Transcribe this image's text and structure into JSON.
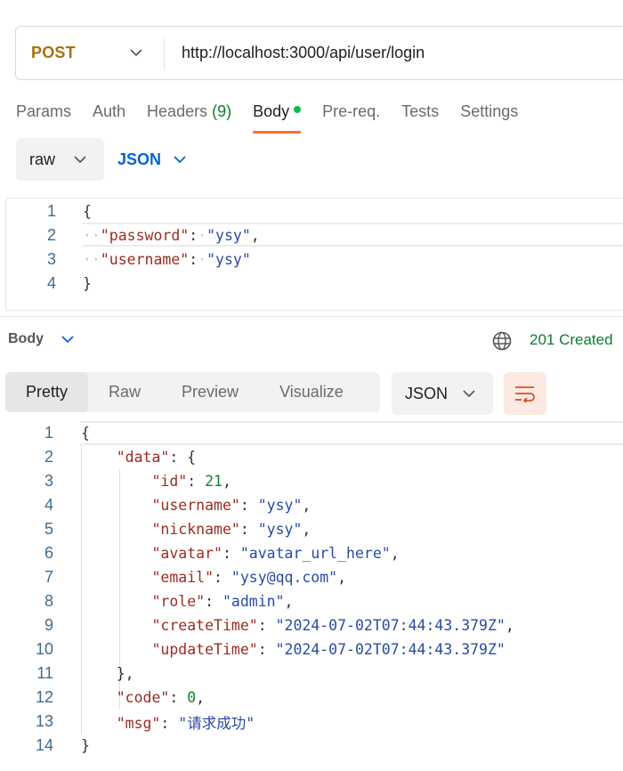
{
  "request": {
    "method": "POST",
    "url": "http://localhost:3000/api/user/login"
  },
  "request_tabs": [
    {
      "label": "Params"
    },
    {
      "label": "Auth"
    },
    {
      "label": "Headers",
      "count": "(9)"
    },
    {
      "label": "Body",
      "active": true
    },
    {
      "label": "Pre-req."
    },
    {
      "label": "Tests"
    },
    {
      "label": "Settings"
    }
  ],
  "body_mode": {
    "selected": "raw",
    "format": "JSON"
  },
  "request_body_lines": [
    {
      "n": "1",
      "text": "{"
    },
    {
      "n": "2",
      "text": "\"password\": \"ysy\","
    },
    {
      "n": "3",
      "text": "\"username\": \"ysy\""
    },
    {
      "n": "4",
      "text": "}"
    }
  ],
  "response": {
    "section_label": "Body",
    "status": "201 Created",
    "view_tabs": [
      "Pretty",
      "Raw",
      "Preview",
      "Visualize"
    ],
    "active_view": "Pretty",
    "format": "JSON",
    "lines": [
      {
        "n": "1",
        "text": "{"
      },
      {
        "n": "2",
        "text": "\"data\": {"
      },
      {
        "n": "3",
        "text": "\"id\": 21,"
      },
      {
        "n": "4",
        "text": "\"username\": \"ysy\","
      },
      {
        "n": "5",
        "text": "\"nickname\": \"ysy\","
      },
      {
        "n": "6",
        "text": "\"avatar\": \"avatar_url_here\","
      },
      {
        "n": "7",
        "text": "\"email\": \"ysy@qq.com\","
      },
      {
        "n": "8",
        "text": "\"role\": \"admin\","
      },
      {
        "n": "9",
        "text": "\"createTime\": \"2024-07-02T07:44:43.379Z\","
      },
      {
        "n": "10",
        "text": "\"updateTime\": \"2024-07-02T07:44:43.379Z\""
      },
      {
        "n": "11",
        "text": "},"
      },
      {
        "n": "12",
        "text": "\"code\": 0,"
      },
      {
        "n": "13",
        "text": "\"msg\": \"请求成功\""
      },
      {
        "n": "14",
        "text": "}"
      }
    ]
  },
  "colors": {
    "method": "#a8720b",
    "accent": "#ff6c37",
    "status_ok": "#0f7b33",
    "json_link": "#0265d2",
    "key": "#9a2c23",
    "string": "#2a4ba3",
    "number": "#15822e"
  },
  "icons": [
    "chevron-down-icon",
    "globe-icon",
    "wrap-lines-icon"
  ]
}
